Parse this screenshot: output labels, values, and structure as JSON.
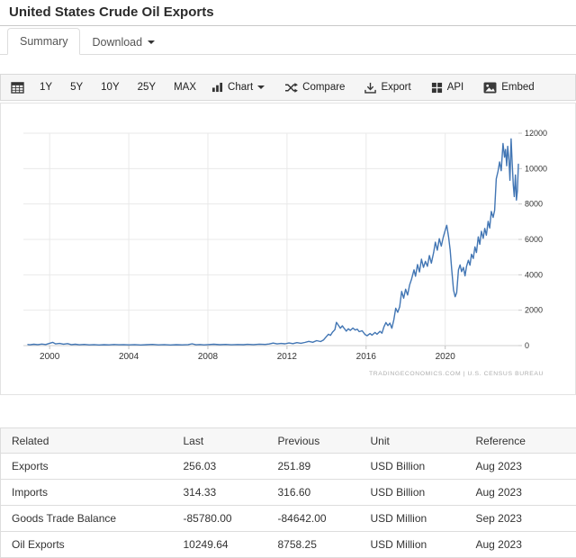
{
  "header": {
    "title": "United States Crude Oil Exports"
  },
  "tabs": {
    "summary": "Summary",
    "download": "Download"
  },
  "toolbar": {
    "calendar_icon": "calendar-icon",
    "ranges": [
      "1Y",
      "5Y",
      "10Y",
      "25Y",
      "MAX"
    ],
    "chart_icon": "bar-chart-icon",
    "chart_label": "Chart",
    "compare_icon": "shuffle-arrows-icon",
    "compare_label": "Compare",
    "export_icon": "download-icon",
    "export_label": "Export",
    "api_icon": "grid-squares-icon",
    "api_label": "API",
    "embed_icon": "picture-icon",
    "embed_label": "Embed"
  },
  "chart_data": {
    "type": "line",
    "title": "United States Crude Oil Exports",
    "ylabel": "",
    "xlabel": "",
    "unit": "USD Million",
    "line_color": "#4276b4",
    "grid_color": "#e9e9e9",
    "axis_color": "#cfcfcf",
    "xlim": [
      1998.9,
      2023.7
    ],
    "ylim": [
      0,
      12000
    ],
    "x_ticks": [
      2000,
      2004,
      2008,
      2012,
      2016,
      2020
    ],
    "y_ticks": [
      0,
      2000,
      4000,
      6000,
      8000,
      10000,
      12000
    ],
    "source": "TRADINGECONOMICS.COM | U.S. CENSUS BUREAU",
    "points": [
      [
        1998.9,
        60
      ],
      [
        1999.0,
        45
      ],
      [
        1999.2,
        75
      ],
      [
        1999.4,
        55
      ],
      [
        1999.6,
        85
      ],
      [
        1999.8,
        60
      ],
      [
        2000.0,
        130
      ],
      [
        2000.15,
        185
      ],
      [
        2000.3,
        95
      ],
      [
        2000.5,
        120
      ],
      [
        2000.7,
        80
      ],
      [
        2000.9,
        110
      ],
      [
        2001.1,
        55
      ],
      [
        2001.3,
        75
      ],
      [
        2001.5,
        45
      ],
      [
        2001.75,
        65
      ],
      [
        2002.0,
        40
      ],
      [
        2002.25,
        55
      ],
      [
        2002.5,
        35
      ],
      [
        2002.75,
        50
      ],
      [
        2003.0,
        40
      ],
      [
        2003.25,
        60
      ],
      [
        2003.5,
        45
      ],
      [
        2003.75,
        55
      ],
      [
        2004.0,
        40
      ],
      [
        2004.3,
        55
      ],
      [
        2004.6,
        35
      ],
      [
        2004.9,
        50
      ],
      [
        2005.2,
        65
      ],
      [
        2005.5,
        40
      ],
      [
        2005.8,
        55
      ],
      [
        2006.1,
        35
      ],
      [
        2006.4,
        50
      ],
      [
        2006.7,
        40
      ],
      [
        2007.0,
        55
      ],
      [
        2007.2,
        100
      ],
      [
        2007.4,
        45
      ],
      [
        2007.6,
        60
      ],
      [
        2007.8,
        40
      ],
      [
        2008.0,
        55
      ],
      [
        2008.3,
        75
      ],
      [
        2008.6,
        50
      ],
      [
        2008.9,
        65
      ],
      [
        2009.2,
        45
      ],
      [
        2009.5,
        60
      ],
      [
        2009.8,
        50
      ],
      [
        2010.0,
        70
      ],
      [
        2010.3,
        55
      ],
      [
        2010.6,
        80
      ],
      [
        2010.9,
        65
      ],
      [
        2011.1,
        90
      ],
      [
        2011.3,
        140
      ],
      [
        2011.5,
        95
      ],
      [
        2011.7,
        120
      ],
      [
        2011.9,
        100
      ],
      [
        2012.1,
        150
      ],
      [
        2012.3,
        110
      ],
      [
        2012.5,
        170
      ],
      [
        2012.7,
        130
      ],
      [
        2012.9,
        180
      ],
      [
        2013.1,
        240
      ],
      [
        2013.3,
        190
      ],
      [
        2013.5,
        280
      ],
      [
        2013.7,
        230
      ],
      [
        2013.85,
        320
      ],
      [
        2014.0,
        520
      ],
      [
        2014.1,
        640
      ],
      [
        2014.2,
        580
      ],
      [
        2014.3,
        760
      ],
      [
        2014.42,
        900
      ],
      [
        2014.5,
        1310
      ],
      [
        2014.6,
        1150
      ],
      [
        2014.7,
        980
      ],
      [
        2014.8,
        1120
      ],
      [
        2014.9,
        960
      ],
      [
        2015.0,
        820
      ],
      [
        2015.1,
        950
      ],
      [
        2015.2,
        860
      ],
      [
        2015.33,
        990
      ],
      [
        2015.45,
        880
      ],
      [
        2015.55,
        930
      ],
      [
        2015.65,
        790
      ],
      [
        2015.8,
        840
      ],
      [
        2015.95,
        620
      ],
      [
        2016.05,
        560
      ],
      [
        2016.2,
        680
      ],
      [
        2016.3,
        590
      ],
      [
        2016.45,
        740
      ],
      [
        2016.55,
        640
      ],
      [
        2016.7,
        810
      ],
      [
        2016.8,
        700
      ],
      [
        2016.9,
        1060
      ],
      [
        2017.0,
        1300
      ],
      [
        2017.1,
        1130
      ],
      [
        2017.2,
        1270
      ],
      [
        2017.3,
        980
      ],
      [
        2017.4,
        1460
      ],
      [
        2017.5,
        2110
      ],
      [
        2017.6,
        1880
      ],
      [
        2017.7,
        2190
      ],
      [
        2017.8,
        3060
      ],
      [
        2017.9,
        2680
      ],
      [
        2018.0,
        3190
      ],
      [
        2018.1,
        2860
      ],
      [
        2018.2,
        3420
      ],
      [
        2018.3,
        3760
      ],
      [
        2018.42,
        4280
      ],
      [
        2018.5,
        3920
      ],
      [
        2018.6,
        4580
      ],
      [
        2018.7,
        4160
      ],
      [
        2018.8,
        4880
      ],
      [
        2018.9,
        4420
      ],
      [
        2019.0,
        4760
      ],
      [
        2019.1,
        4480
      ],
      [
        2019.2,
        5090
      ],
      [
        2019.3,
        4660
      ],
      [
        2019.42,
        5280
      ],
      [
        2019.5,
        5840
      ],
      [
        2019.6,
        5390
      ],
      [
        2019.7,
        6040
      ],
      [
        2019.8,
        5620
      ],
      [
        2019.9,
        6120
      ],
      [
        2020.0,
        6520
      ],
      [
        2020.08,
        6800
      ],
      [
        2020.17,
        6150
      ],
      [
        2020.25,
        5400
      ],
      [
        2020.33,
        4300
      ],
      [
        2020.42,
        3150
      ],
      [
        2020.5,
        2760
      ],
      [
        2020.58,
        2980
      ],
      [
        2020.67,
        4280
      ],
      [
        2020.75,
        4560
      ],
      [
        2020.83,
        4180
      ],
      [
        2020.92,
        4420
      ],
      [
        2021.0,
        3940
      ],
      [
        2021.08,
        4480
      ],
      [
        2021.17,
        4820
      ],
      [
        2021.25,
        4540
      ],
      [
        2021.33,
        5160
      ],
      [
        2021.42,
        4920
      ],
      [
        2021.5,
        5580
      ],
      [
        2021.58,
        5260
      ],
      [
        2021.67,
        6140
      ],
      [
        2021.75,
        5720
      ],
      [
        2021.83,
        6460
      ],
      [
        2021.92,
        6060
      ],
      [
        2022.0,
        6620
      ],
      [
        2022.08,
        6240
      ],
      [
        2022.17,
        7020
      ],
      [
        2022.25,
        6640
      ],
      [
        2022.33,
        7580
      ],
      [
        2022.42,
        7240
      ],
      [
        2022.5,
        7640
      ],
      [
        2022.58,
        9420
      ],
      [
        2022.67,
        9860
      ],
      [
        2022.75,
        10380
      ],
      [
        2022.83,
        9880
      ],
      [
        2022.92,
        11420
      ],
      [
        2023.0,
        10640
      ],
      [
        2023.05,
        11080
      ],
      [
        2023.11,
        10160
      ],
      [
        2023.16,
        11260
      ],
      [
        2023.22,
        10480
      ],
      [
        2023.27,
        9340
      ],
      [
        2023.33,
        11680
      ],
      [
        2023.38,
        10420
      ],
      [
        2023.44,
        9080
      ],
      [
        2023.49,
        8420
      ],
      [
        2023.55,
        9640
      ],
      [
        2023.6,
        8220
      ],
      [
        2023.65,
        8758
      ],
      [
        2023.7,
        10250
      ]
    ]
  },
  "table": {
    "columns": [
      "Related",
      "Last",
      "Previous",
      "Unit",
      "Reference"
    ],
    "rows": [
      {
        "related": "Exports",
        "last": "256.03",
        "previous": "251.89",
        "unit": "USD Billion",
        "reference": "Aug 2023"
      },
      {
        "related": "Imports",
        "last": "314.33",
        "previous": "316.60",
        "unit": "USD Billion",
        "reference": "Aug 2023"
      },
      {
        "related": "Goods Trade Balance",
        "last": "-85780.00",
        "previous": "-84642.00",
        "unit": "USD Million",
        "reference": "Sep 2023"
      },
      {
        "related": "Oil Exports",
        "last": "10249.64",
        "previous": "8758.25",
        "unit": "USD Million",
        "reference": "Aug 2023"
      }
    ]
  }
}
